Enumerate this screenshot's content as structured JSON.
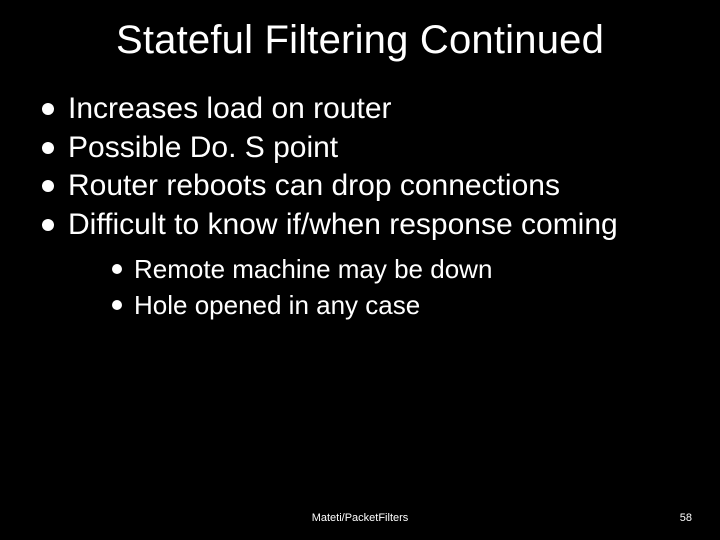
{
  "title": "Stateful Filtering Continued",
  "bullets": [
    {
      "text": "Increases load on router"
    },
    {
      "text": "Possible Do. S point"
    },
    {
      "text": "Router reboots can drop connections"
    },
    {
      "text": "Difficult to know if/when response coming"
    }
  ],
  "sub_bullets": [
    {
      "text": "Remote machine may be down"
    },
    {
      "text": "Hole opened in any case"
    }
  ],
  "footer": {
    "center": "Mateti/PacketFilters",
    "page": "58"
  }
}
